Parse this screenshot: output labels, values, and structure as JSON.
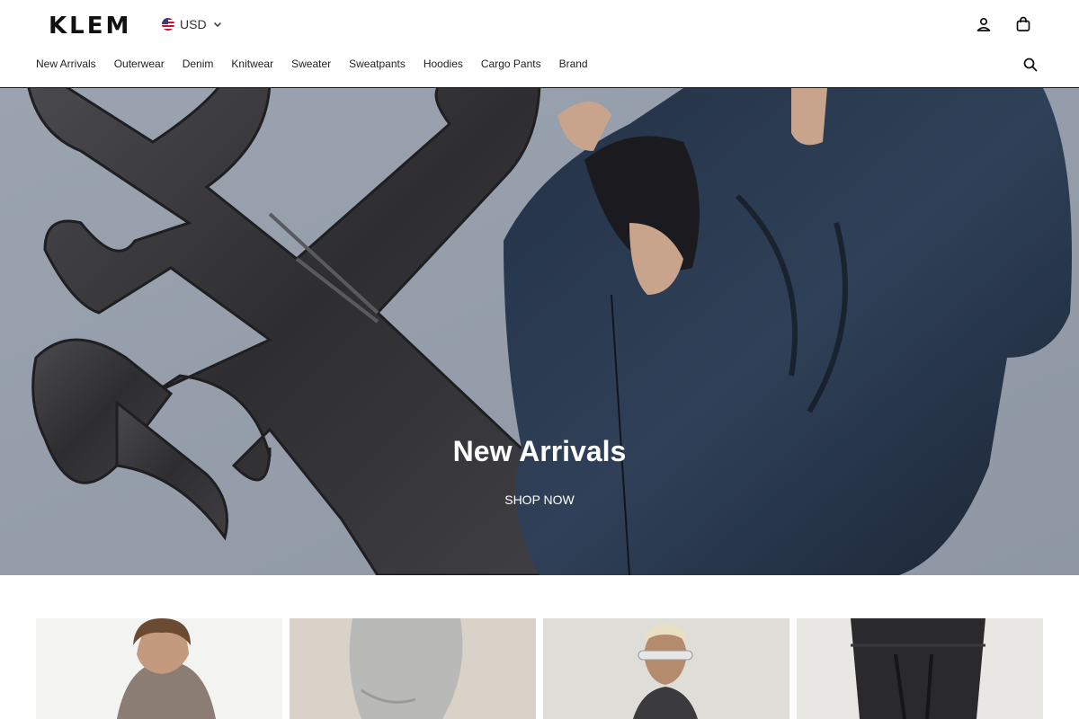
{
  "brand": {
    "logo": "KLEM"
  },
  "header": {
    "currency": {
      "code": "USD",
      "flag": "us-flag-icon"
    },
    "icons": [
      "account-icon",
      "cart-icon",
      "search-icon"
    ]
  },
  "nav": {
    "items": [
      {
        "label": "New Arrivals"
      },
      {
        "label": "Outerwear"
      },
      {
        "label": "Denim"
      },
      {
        "label": "Knitwear"
      },
      {
        "label": "Sweater"
      },
      {
        "label": "Sweatpants"
      },
      {
        "label": "Hoodies"
      },
      {
        "label": "Cargo Pants"
      },
      {
        "label": "Brand"
      }
    ]
  },
  "hero": {
    "title": "New Arrivals",
    "cta": "SHOP NOW"
  },
  "colors": {
    "hero_bg": "#98a0ac",
    "text": "#111111",
    "header_border": "#1a1a1a"
  }
}
